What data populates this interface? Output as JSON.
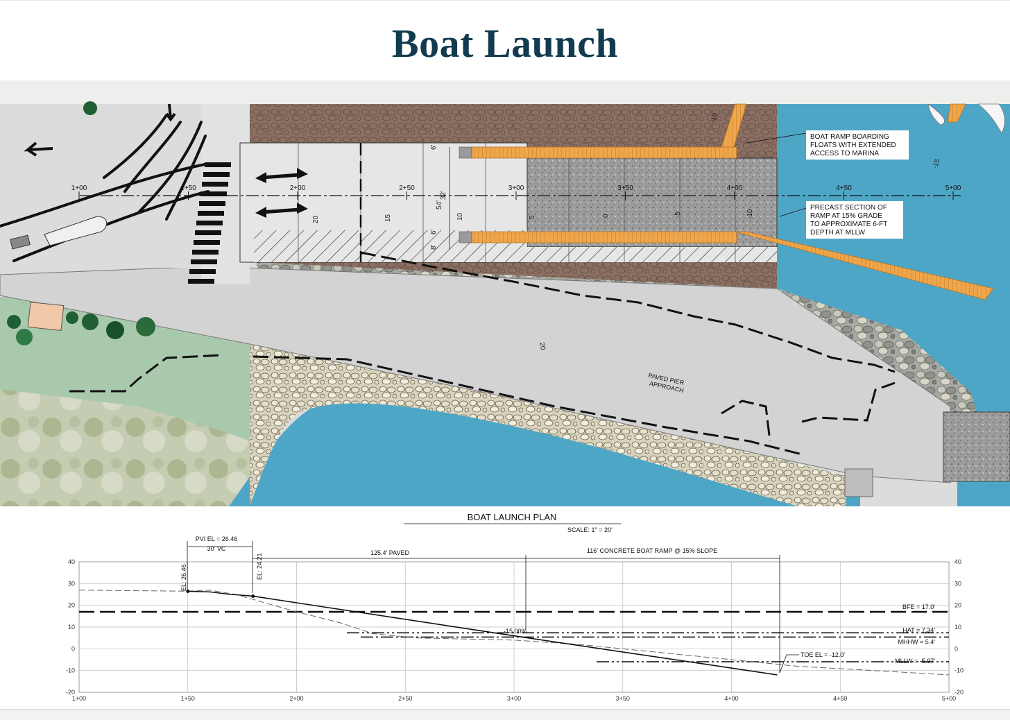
{
  "page": {
    "title": "Boat Launch"
  },
  "plan": {
    "stations": [
      "1+00",
      "1+50",
      "2+00",
      "2+50",
      "3+00",
      "3+50",
      "4+00",
      "4+50",
      "5+00"
    ],
    "contour_labels": [
      "20",
      "15",
      "10",
      "5",
      "0",
      "-5",
      "-10",
      "-10",
      "-15",
      "20"
    ],
    "dimensions": [
      "6'",
      "54'",
      "32'",
      "6'",
      "8'"
    ],
    "notes": {
      "boarding_floats": [
        "BOAT RAMP BOARDING",
        "FLOATS WITH EXTENDED",
        "ACCESS TO MARINA"
      ],
      "precast_section": [
        "PRECAST SECTION OF",
        "RAMP AT 15% GRADE",
        "TO APPROXIMATE 6-FT",
        "DEPTH AT MLLW"
      ],
      "paved_pier": [
        "PAVED PIER",
        "APPROACH"
      ]
    },
    "colors": {
      "water": "#4ea6c6",
      "ground": "#dcdcdc",
      "grass": "#a9c9ad",
      "riprap": "#8b6f62",
      "float": "#efa64b",
      "pavement": "#d3d3d3"
    }
  },
  "profile": {
    "plan_title": "BOAT LAUNCH PLAN",
    "scale": "SCALE: 1\" = 20'",
    "pvi_label": "PVI EL = 26.46",
    "vc_label": "30' VC",
    "el_labels": [
      "EL: 26.46",
      "EL: 24.21"
    ],
    "paved_label": "125.4' PAVED",
    "ramp_label": "116' CONCRETE BOAT RAMP @ 15% SLOPE",
    "slope_label": "-15.00%",
    "toe_label": "TOE EL = -12.0'",
    "water_levels": [
      {
        "label": "BFE = 17.0'",
        "elev": 17.0
      },
      {
        "label": "HAT = 7.34'",
        "elev": 7.34
      },
      {
        "label": "MHHW = 5.4'",
        "elev": 5.4
      },
      {
        "label": "MLLW = -5.97'",
        "elev": -5.97
      }
    ],
    "y_ticks": [
      "40",
      "30",
      "20",
      "10",
      "0",
      "-10",
      "-20"
    ],
    "x_ticks": [
      "1+00",
      "1+50",
      "2+00",
      "2+50",
      "3+00",
      "3+50",
      "4+00",
      "4+50",
      "5+00"
    ]
  }
}
